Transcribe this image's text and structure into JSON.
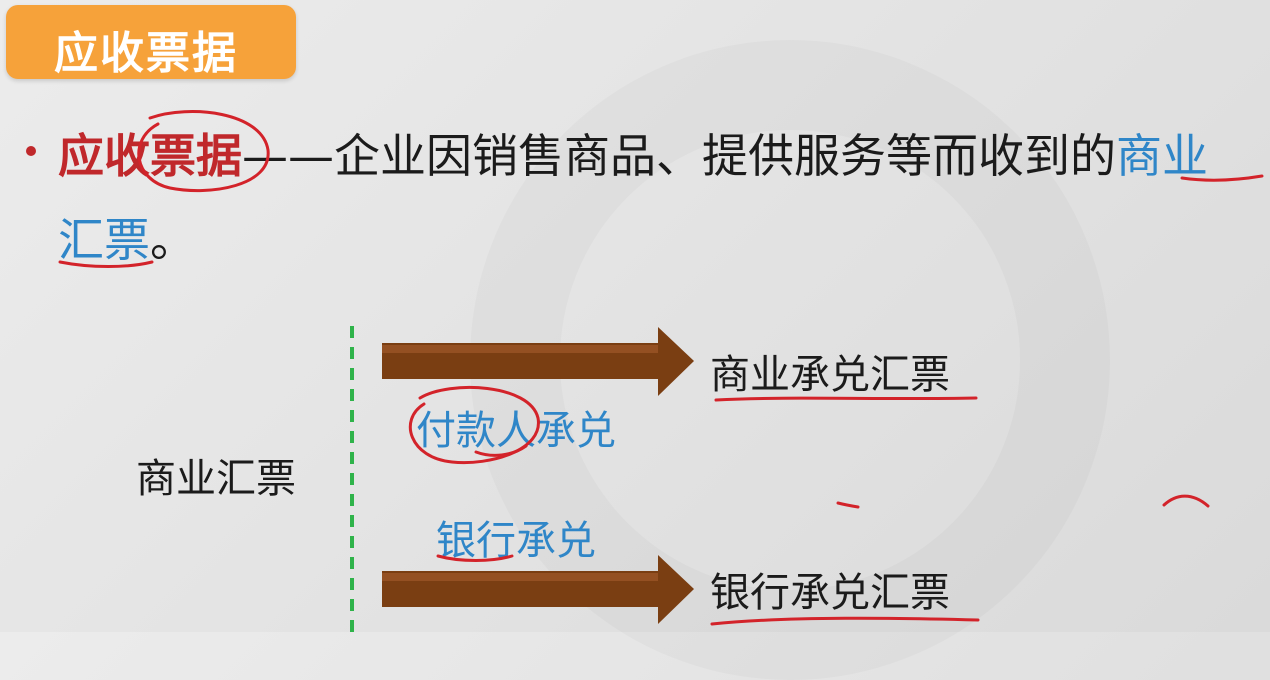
{
  "header": {
    "title": "应收票据"
  },
  "definition": {
    "term": "应收票据",
    "dash": "——",
    "text": "企业因销售商品、提供服务等而收到的",
    "highlight_part1": "商业",
    "highlight_part2": "汇票",
    "period": "。"
  },
  "diagram": {
    "root": "商业汇票",
    "upper_result": "商业承兑汇票",
    "upper_condition": "付款人承兑",
    "lower_condition": "银行承兑",
    "lower_result": "银行承兑汇票"
  },
  "colors": {
    "header_bg": "#f6a23a",
    "term_red": "#c0282b",
    "highlight_blue": "#2f86c8",
    "arrow_brown": "#7a3e12",
    "divider_green": "#2fb34a",
    "annotation_red": "#d3232a"
  }
}
